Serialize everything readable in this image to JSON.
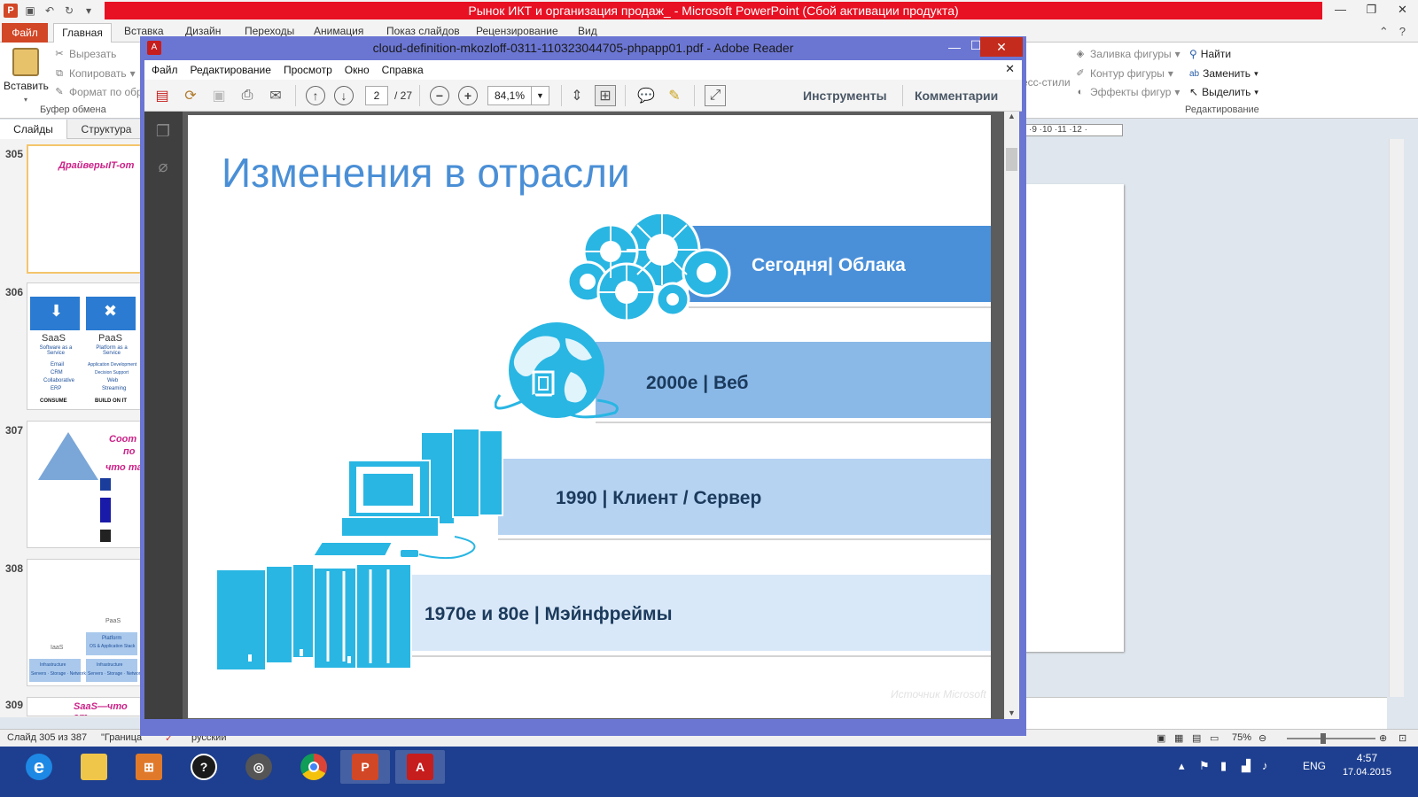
{
  "powerpoint": {
    "title": "Рынок ИКТ и организация продаж_ - Microsoft PowerPoint (Сбой активации продукта)",
    "tabs": [
      "Файл",
      "Главная",
      "Вставка",
      "Дизайн",
      "Переходы",
      "Анимация",
      "Показ слайдов",
      "Рецензирование",
      "Вид"
    ],
    "ribbon": {
      "paste": "Вставить",
      "cut": "Вырезать",
      "copy": "Копировать",
      "format": "Формат по обр",
      "clipboard_group": "Буфер обмена",
      "fill": "Заливка фигуры",
      "outline": "Контур фигуры",
      "effects": "Эффекты фигур",
      "express_styles": "есс-стили",
      "find": "Найти",
      "replace": "Заменить",
      "select": "Выделить",
      "editing_group": "Редактирование"
    },
    "left_tabs": [
      "Слайды",
      "Структура"
    ],
    "thumbnails": [
      {
        "num": "305",
        "title": "ДрайверыIT-от"
      },
      {
        "num": "306",
        "saas": "SaaS",
        "saas_sub": "Software as a Service",
        "paas": "PaaS",
        "paas_sub": "Platform as a Service",
        "consume": "CONSUME",
        "build": "BUILD ON IT",
        "saas_items": [
          "Email",
          "CRM",
          "Collaborative",
          "ERP"
        ],
        "paas_items": [
          "Application Development",
          "Decision Support",
          "Web",
          "Streaming"
        ]
      },
      {
        "num": "307",
        "title": "Соот",
        "line2": "по",
        "line3": "что та"
      },
      {
        "num": "308",
        "paas": "PaaS",
        "platform": "Platform",
        "platform_sub": "OS & Application Stack",
        "iaas": "IaaS",
        "infra": "Infrastructure",
        "infra_sub": "Servers · Storage · Network"
      },
      {
        "num": "309",
        "title": "SaaS—что эт"
      }
    ],
    "ruler": "·9 ·10 ·11 ·12 ·",
    "status": {
      "slide": "Слайд 305 из 387",
      "theme": "\"Граница\"",
      "language": "русский",
      "zoom": "75%"
    }
  },
  "reader": {
    "title": "cloud-definition-mkozloff-0311-110323044705-phpapp01.pdf - Adobe Reader",
    "menu": [
      "Файл",
      "Редактирование",
      "Просмотр",
      "Окно",
      "Справка"
    ],
    "page_current": "2",
    "page_total": "/ 27",
    "zoom": "84,1%",
    "tools_label": "Инструменты",
    "comments_label": "Комментарии"
  },
  "slide": {
    "title": "Изменения в отрасли",
    "bands": [
      {
        "label": "Сегодня| Облака",
        "color": "#4a90d9",
        "text_color": "#ffffff"
      },
      {
        "label": "2000е | Веб",
        "color": "#8ab9e8",
        "text_color": "#1b3a5c"
      },
      {
        "label": "1990 | Клиент / Сервер",
        "color": "#b6d3f2",
        "text_color": "#1b3a5c"
      },
      {
        "label": "1970е и 80е | Мэйнфреймы",
        "color": "#d9e8f8",
        "text_color": "#1b3a5c"
      }
    ],
    "source": "Источник Microsoft"
  },
  "taskbar": {
    "lang": "ENG",
    "time": "4:57",
    "date": "17.04.2015"
  },
  "colors": {
    "ppt_red": "#e81123",
    "ppt_file": "#d24726",
    "reader_frame": "#6b76d3",
    "taskbar": "#1e3f8f",
    "icon_cyan": "#29b6e3"
  }
}
